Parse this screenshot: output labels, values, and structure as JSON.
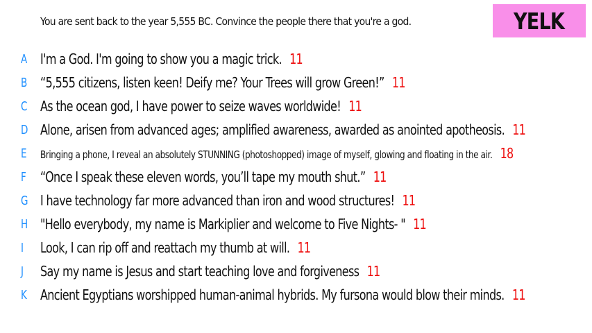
{
  "prompt": "You are sent back to the year 5,555 BC. Convince the people there that you're a god.",
  "badge": "YELK",
  "colors": {
    "letter": "#1e8fff",
    "score": "#ee1111",
    "badge_bg": "#f98fe9"
  },
  "answers": [
    {
      "letter": "A",
      "text": "I'm a God. I'm going to show you a magic trick.",
      "score": "11"
    },
    {
      "letter": "B",
      "text": "“5,555 citizens, listen keen! Deify me? Your Trees will grow Green!”",
      "score": "11"
    },
    {
      "letter": "C",
      "text": "As the ocean god, I have power to seize waves worldwide!",
      "score": "11"
    },
    {
      "letter": "D",
      "text": "Alone, arisen from advanced ages; amplified awareness, awarded as anointed apotheosis.",
      "score": "11"
    },
    {
      "letter": "E",
      "text": "Bringing a phone, I reveal an absolutely STUNNING (photoshopped) image of myself, glowing and floating in the air.",
      "score": "18"
    },
    {
      "letter": "F",
      "text": "“Once I speak these eleven words, you’ll tape my mouth shut.”",
      "score": "11"
    },
    {
      "letter": "G",
      "text": "I have technology far more advanced than iron and wood structures!",
      "score": "11"
    },
    {
      "letter": "H",
      "text": "\"Hello everybody, my name is Markiplier and welcome to Five Nights- \"",
      "score": "11"
    },
    {
      "letter": "I",
      "text": "Look, I can rip off and reattach my thumb at will.",
      "score": "11"
    },
    {
      "letter": "J",
      "text": "Say my name is Jesus and start teaching love and forgiveness",
      "score": "11"
    },
    {
      "letter": "K",
      "text": "Ancient Egyptians worshipped human-animal hybrids. My fursona would blow their minds.",
      "score": "11"
    }
  ]
}
